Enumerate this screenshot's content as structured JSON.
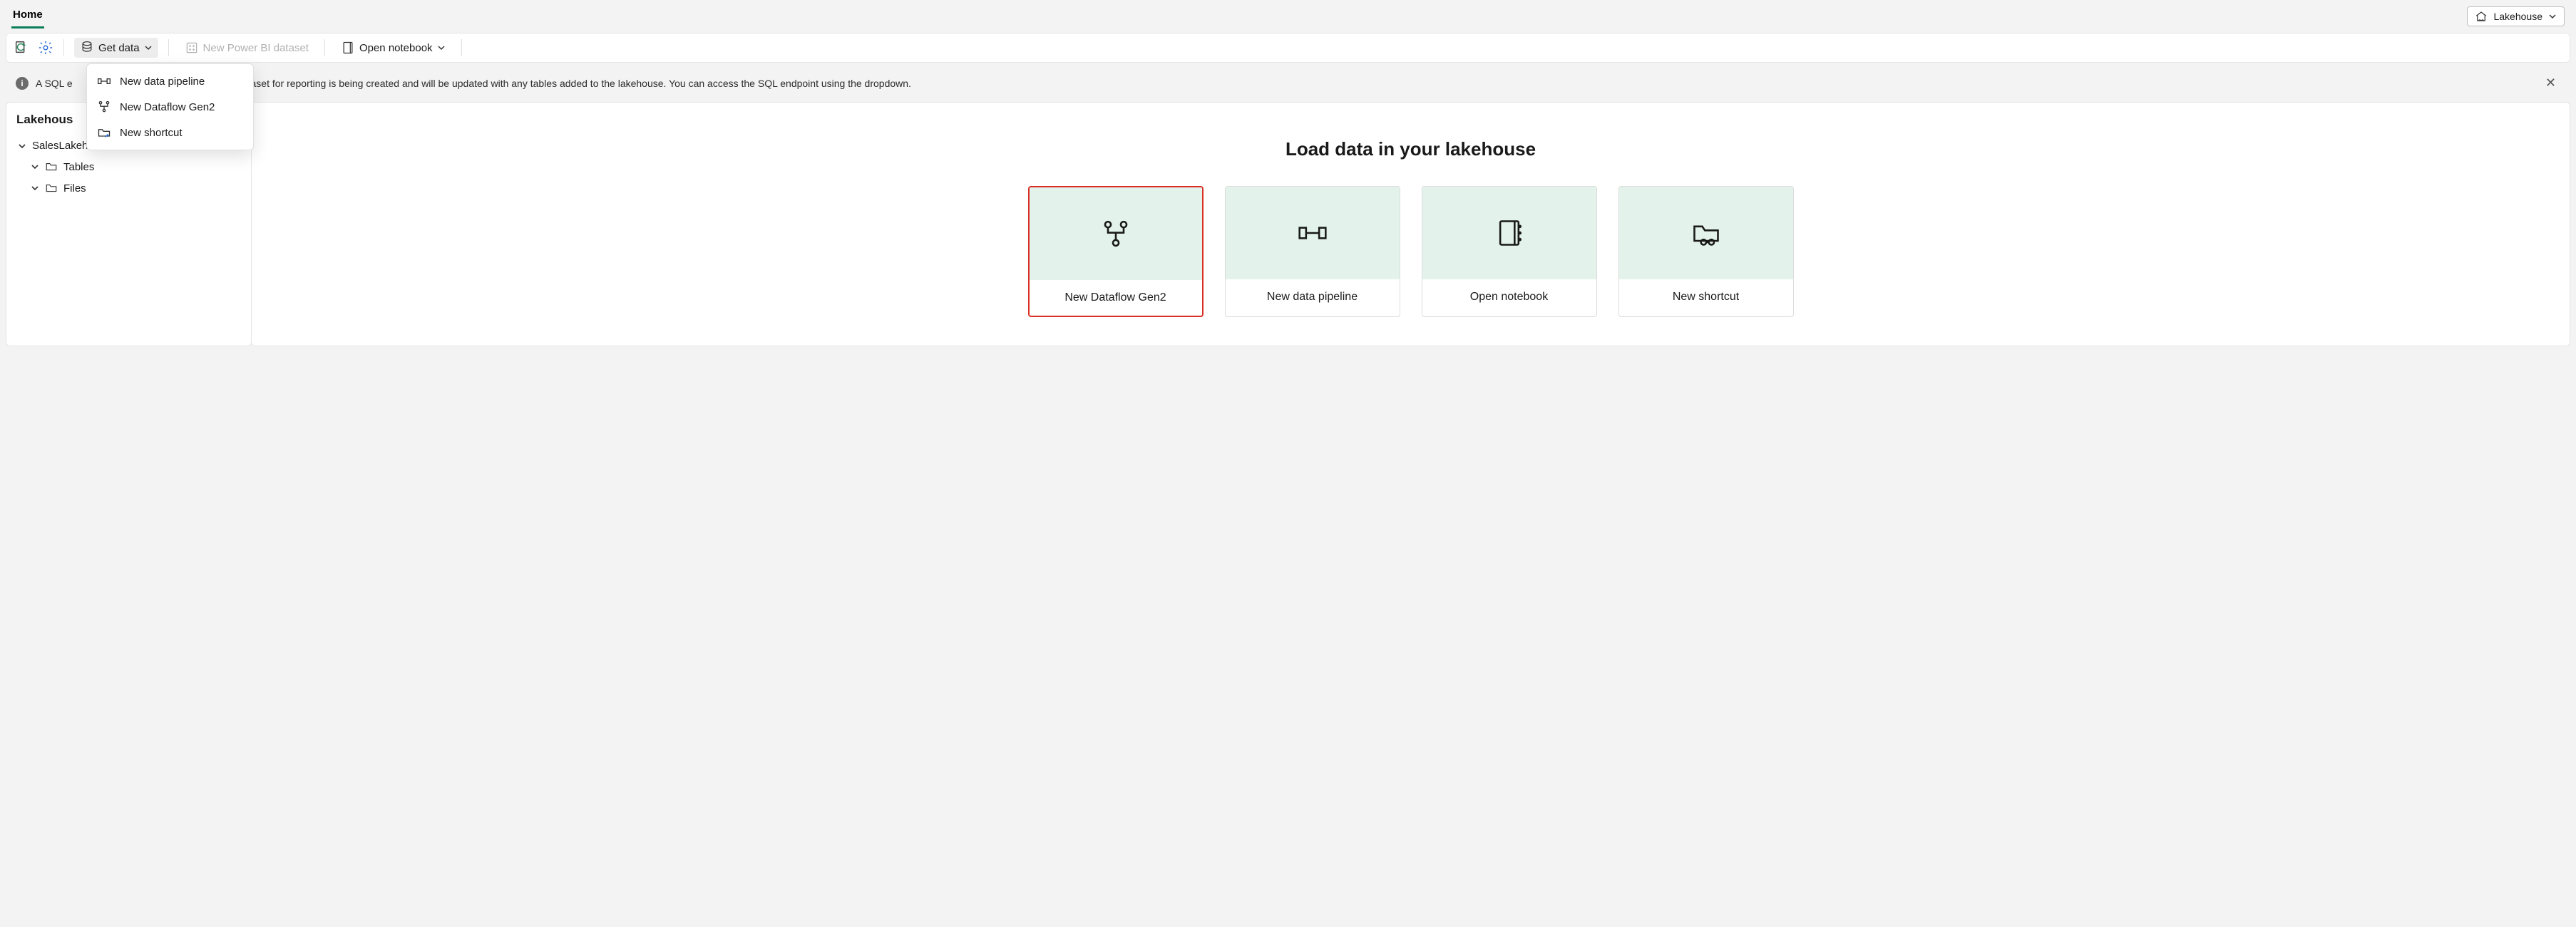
{
  "topbar": {
    "tab": "Home",
    "lakehouse_dropdown": "Lakehouse"
  },
  "ribbon": {
    "getdata": "Get data",
    "newdataset": "New Power BI dataset",
    "opennotebook": "Open notebook"
  },
  "getdata_menu": {
    "pipeline": "New data pipeline",
    "dataflow": "New Dataflow Gen2",
    "shortcut": "New shortcut"
  },
  "notification": {
    "text_prefix": "A SQL e",
    "text_suffix": "efault dataset for reporting is being created and will be updated with any tables added to the lakehouse. You can access the SQL endpoint using the dropdown."
  },
  "explorer": {
    "title": "Lakehous",
    "root": "SalesLakehouse",
    "tables": "Tables",
    "files": "Files"
  },
  "main": {
    "heading": "Load data in your lakehouse",
    "cards": {
      "dataflow": "New Dataflow Gen2",
      "pipeline": "New data pipeline",
      "notebook": "Open notebook",
      "shortcut": "New shortcut"
    }
  }
}
